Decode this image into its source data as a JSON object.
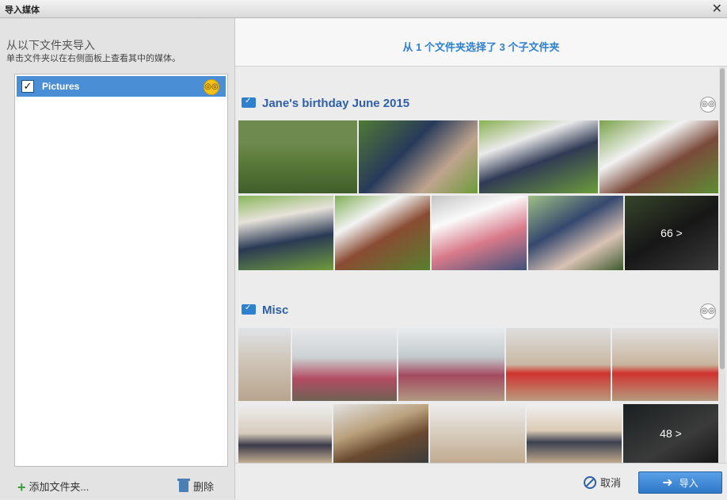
{
  "window": {
    "title": "导入媒体",
    "close_glyph": "✕"
  },
  "left": {
    "heading": "从以下文件夹导入",
    "subheading": "单击文件夹以在右侧面板上查看其中的媒体。",
    "folders": [
      {
        "name": "Pictures",
        "checked": true
      }
    ],
    "add_folder_label": "添加文件夹...",
    "delete_label": "删除"
  },
  "right": {
    "summary": "从 1 个文件夹选择了 3 个子文件夹",
    "sections": [
      {
        "title": "Jane's birthday June 2015",
        "more_label": "66 >"
      },
      {
        "title": "Misc",
        "more_label": "48 >"
      }
    ],
    "cancel_label": "取消",
    "import_label": "导入"
  },
  "icons": {
    "binoculars": "binoculars-icon",
    "folder": "folder-icon",
    "plus": "plus-icon",
    "trash": "trash-icon",
    "cancel": "cancel-icon",
    "import": "import-arrow-icon"
  },
  "colors": {
    "accent": "#2f7fcf",
    "selection": "#4a8fd6",
    "binocular_badge": "#f2c21b"
  }
}
